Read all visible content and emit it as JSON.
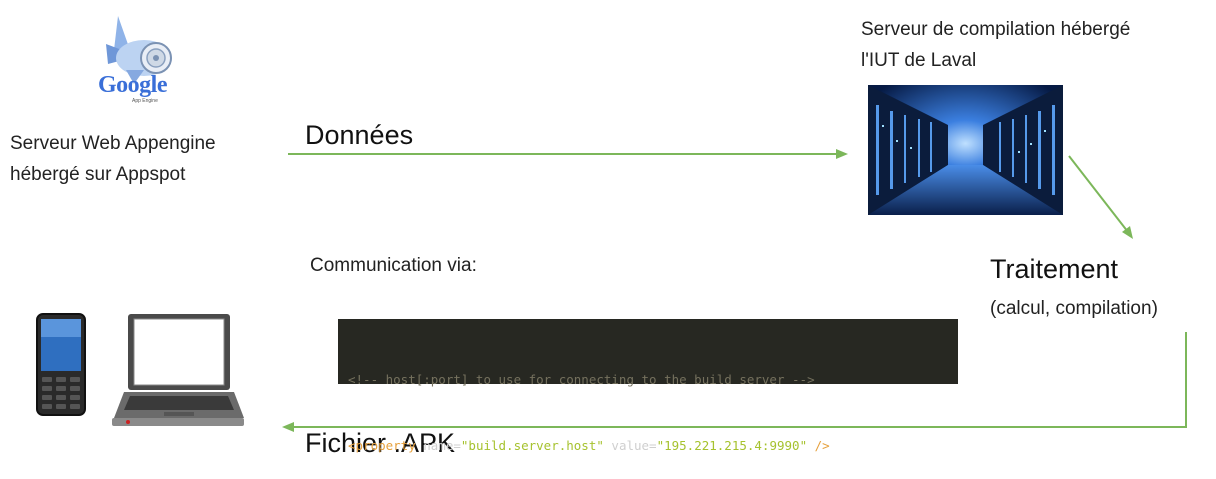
{
  "appengine": {
    "logo_word": "Google",
    "logo_sub": "App Engine",
    "caption_line1": "Serveur Web Appengine",
    "caption_line2": "hébergé sur Appspot"
  },
  "server": {
    "caption_line1": "Serveur de compilation hébergé",
    "caption_line2": "l'IUT de Laval"
  },
  "arrows": {
    "donnees": "Données",
    "fichier": "Fichier .APK"
  },
  "traitement": {
    "title": "Traitement",
    "detail": "(calcul, compilation)"
  },
  "communication": {
    "label": "Communication via:",
    "code_line1": "<!-- host[:port] to use for connecting to the build server -->",
    "code_tag_open": "<property",
    "code_attr_name": " name=",
    "code_name_value": "\"build.server.host\"",
    "code_attr_value": " value=",
    "code_value_value": "\"195.221.215.4:9990\"",
    "code_tag_close": " />"
  },
  "colors": {
    "arrow": "#7cb75a",
    "code_bg": "#272822"
  }
}
